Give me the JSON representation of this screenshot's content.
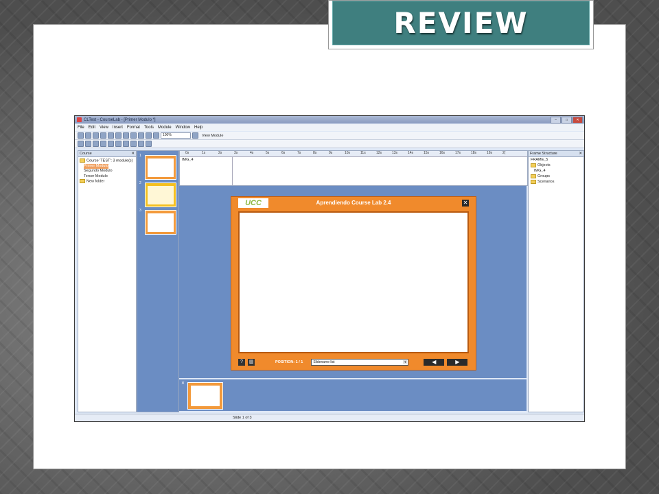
{
  "banner": {
    "title": "REVIEW"
  },
  "app": {
    "window_title": "CLTest - CourseLab - [Primer Modulo *]",
    "menu": [
      "File",
      "Edit",
      "View",
      "Insert",
      "Format",
      "Tools",
      "Module",
      "Window",
      "Help"
    ],
    "zoom": "100%",
    "view_module_label": "View Module",
    "course_pane": {
      "title": "Course",
      "tree": {
        "root": "Course 'TEST': 3 module(s)",
        "items": [
          "Primer Modulo",
          "Segundo Modulo",
          "Tercer Modulo"
        ],
        "folder": "New folder"
      }
    },
    "thumbnails": [
      "1",
      "2",
      "3"
    ],
    "timeline": {
      "ticks": [
        "0s",
        "1s",
        "2s",
        "3s",
        "4s",
        "5s",
        "6s",
        "7s",
        "8s",
        "9s",
        "10s",
        "11s",
        "12s",
        "13s",
        "14s",
        "15s",
        "16s",
        "17s",
        "18s",
        "19s",
        "2("
      ],
      "object": "IMG_4"
    },
    "player": {
      "logo": "UCC",
      "title": "Aprendiendo Course Lab 2.4",
      "close": "✕",
      "help": "?",
      "menu_btn": "▥",
      "position": "POSITION: 1 / 1",
      "slide_select": "Slidename list",
      "prev": "◀",
      "next": "▶"
    },
    "frame_pane": {
      "title": "Frame Structure",
      "frame": "FRAME_5",
      "objects": "Objects",
      "object_item": "IMG_4",
      "groups": "Groups",
      "scenarios": "Scenarios"
    },
    "status": "Slide 1 of 3"
  }
}
